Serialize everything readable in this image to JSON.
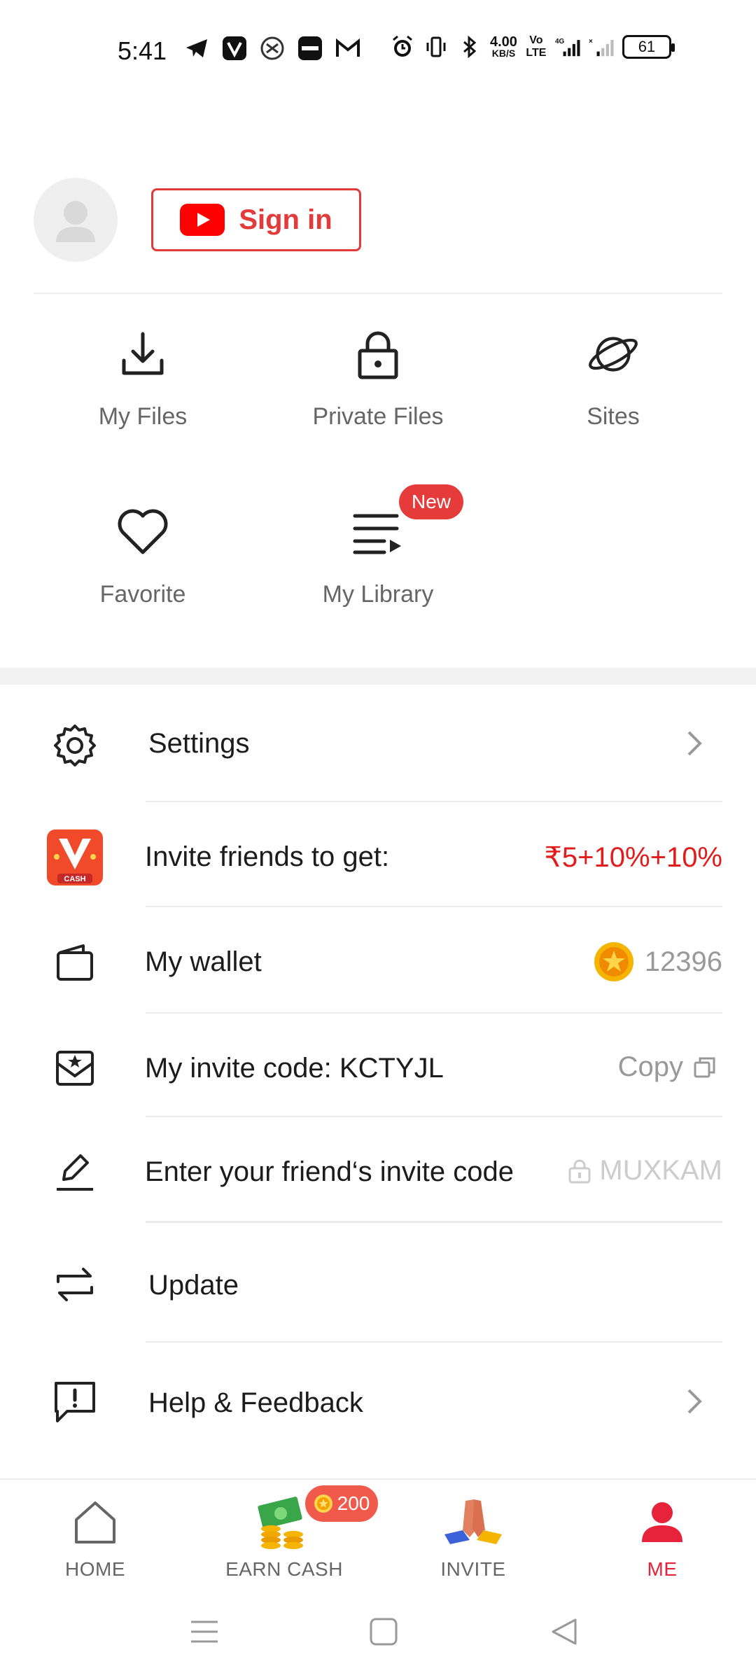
{
  "status_bar": {
    "time": "5:41",
    "net_speed_value": "4.00",
    "net_speed_unit": "KB/S",
    "volte": "Vo LTE",
    "network": "4G",
    "battery": "61"
  },
  "profile": {
    "sign_in_label": "Sign in"
  },
  "grid": {
    "items": [
      {
        "label": "My Files",
        "icon": "download-icon"
      },
      {
        "label": "Private Files",
        "icon": "lock-icon"
      },
      {
        "label": "Sites",
        "icon": "planet-icon"
      },
      {
        "label": "Favorite",
        "icon": "heart-icon"
      },
      {
        "label": "My Library",
        "icon": "playlist-icon",
        "badge": "New"
      }
    ]
  },
  "menu": {
    "settings": {
      "label": "Settings"
    },
    "invite": {
      "label": "Invite friends to get:",
      "value": "₹5+10%+10%",
      "app_icon_text": "CASH"
    },
    "wallet": {
      "label": "My wallet",
      "value": "12396"
    },
    "invite_code": {
      "label": "My invite code: KCTYJL",
      "action": "Copy"
    },
    "friend_code": {
      "label": "Enter your friend‘s invite code",
      "value": "MUXKAM"
    },
    "update": {
      "label": "Update"
    },
    "help": {
      "label": "Help & Feedback"
    }
  },
  "bottom_nav": {
    "items": [
      {
        "label": "HOME",
        "icon": "home-icon"
      },
      {
        "label": "EARN CASH",
        "icon": "cash-icon",
        "badge": "200"
      },
      {
        "label": "INVITE",
        "icon": "invite-icon"
      },
      {
        "label": "ME",
        "icon": "person-icon",
        "active": true
      }
    ]
  },
  "colors": {
    "accent": "#e33a3a",
    "active_nav": "#e6233a",
    "muted_text": "#999999"
  }
}
